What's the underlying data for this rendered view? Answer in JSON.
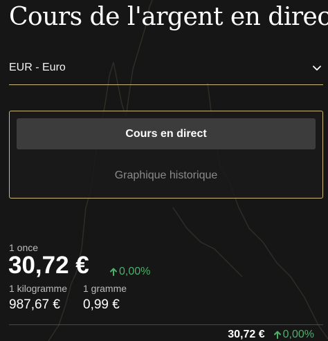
{
  "title": "Cours de l'argent en direct",
  "currency": {
    "selected": "EUR - Euro",
    "icon": "chevron-down-icon"
  },
  "modes": {
    "live": "Cours en direct",
    "history": "Graphique historique"
  },
  "prices": {
    "ounce": {
      "label": "1 once",
      "value": "30,72 €",
      "change": "0,00%"
    },
    "kilogram": {
      "label": "1 kilogramme",
      "value": "987,67 €"
    },
    "gram": {
      "label": "1 gramme",
      "value": "0,99 €"
    }
  },
  "ticker": {
    "value": "30,72 €",
    "change": "0,00%"
  },
  "colors": {
    "accent": "#cdb978",
    "positive": "#4caf6a",
    "background": "#161616",
    "button": "#3c3c3c"
  }
}
